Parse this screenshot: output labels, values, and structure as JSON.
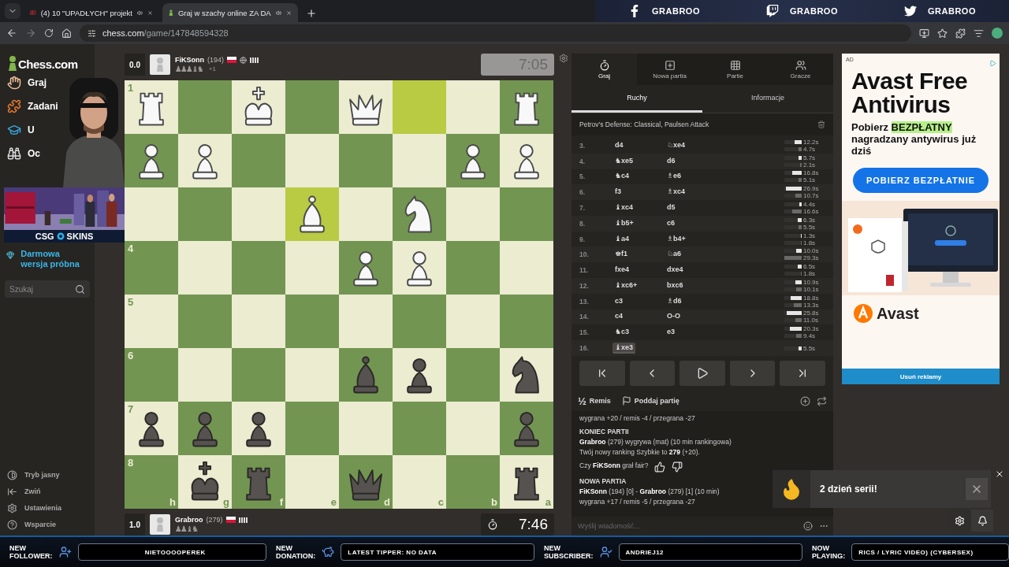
{
  "browser": {
    "tabs": [
      {
        "title": "(4) 10 \"UPADŁYCH\" projekt",
        "kind": "video",
        "selected": false,
        "audio": true
      },
      {
        "title": "Graj w szachy online ZA DA",
        "kind": "chess",
        "selected": true,
        "audio": true
      }
    ],
    "address": {
      "host": "chess.com",
      "path": "/game/147848594328"
    }
  },
  "socials": [
    {
      "kind": "facebook",
      "handle": "GRABROO"
    },
    {
      "kind": "twitch",
      "handle": "GRABROO"
    },
    {
      "kind": "twitter",
      "handle": "GRABROO"
    }
  ],
  "sidebar": {
    "logo": "Chess.com",
    "nav": [
      {
        "kind": "play",
        "label": "Graj"
      },
      {
        "kind": "puzzles",
        "label": "Zadani"
      },
      {
        "kind": "learn",
        "label": "U"
      },
      {
        "kind": "watch",
        "label": "Oc"
      }
    ],
    "trial": "Darmowa wersja próbna",
    "search": {
      "placeholder": "Szukaj"
    },
    "footer": [
      {
        "kind": "theme",
        "label": "Tryb jasny"
      },
      {
        "kind": "collapse",
        "label": "Zwiń"
      },
      {
        "kind": "settings",
        "label": "Ustawienia"
      },
      {
        "kind": "help",
        "label": "Wsparcie"
      }
    ]
  },
  "stream_banner": {
    "brand_left": "CSG",
    "brand_right": "SKINS"
  },
  "top_player": {
    "score": "0.0",
    "name": "FiKSonn",
    "rating": "(194)",
    "captured": "♟♟♟♝♞",
    "advantage": "+1",
    "clock": {
      "time": "7:05",
      "active": false
    }
  },
  "bottom_player": {
    "score": "1.0",
    "name": "Grabroo",
    "rating": "(279)",
    "captured": "♟♟♝♞",
    "clock": {
      "time": "7:46",
      "active": true
    }
  },
  "board": {
    "rows": [
      {
        "squares": [
          {
            "kind": "rook",
            "white": true,
            "highlighted": false,
            "rank_label": "1"
          },
          {
            "highlighted": false
          },
          {
            "kind": "king",
            "white": true,
            "highlighted": false
          },
          {
            "highlighted": false
          },
          {
            "kind": "queen",
            "white": true,
            "highlighted": false
          },
          {
            "highlighted": true
          },
          {
            "highlighted": false
          },
          {
            "kind": "rook",
            "white": true,
            "highlighted": false
          }
        ]
      },
      {
        "squares": [
          {
            "kind": "pawn",
            "white": true,
            "highlighted": false
          },
          {
            "kind": "pawn",
            "white": true,
            "highlighted": false
          },
          {
            "highlighted": false
          },
          {
            "highlighted": false
          },
          {
            "highlighted": false
          },
          {
            "highlighted": false
          },
          {
            "kind": "pawn",
            "white": true,
            "highlighted": false
          },
          {
            "kind": "pawn",
            "white": true,
            "highlighted": false
          }
        ]
      },
      {
        "squares": [
          {
            "highlighted": false
          },
          {
            "highlighted": false
          },
          {
            "highlighted": false
          },
          {
            "kind": "bishop",
            "white": true,
            "highlighted": true
          },
          {
            "highlighted": false
          },
          {
            "kind": "knight",
            "white": true,
            "highlighted": false
          },
          {
            "highlighted": false
          },
          {
            "highlighted": false
          }
        ]
      },
      {
        "squares": [
          {
            "highlighted": false,
            "rank_label": "4"
          },
          {
            "highlighted": false
          },
          {
            "highlighted": false
          },
          {
            "highlighted": false
          },
          {
            "kind": "pawn",
            "white": true,
            "highlighted": false
          },
          {
            "kind": "pawn",
            "white": true,
            "highlighted": false
          },
          {
            "highlighted": false
          },
          {
            "highlighted": false
          }
        ]
      },
      {
        "squares": [
          {
            "highlighted": false,
            "rank_label": "5"
          },
          {
            "highlighted": false
          },
          {
            "highlighted": false
          },
          {
            "highlighted": false
          },
          {
            "highlighted": false
          },
          {
            "highlighted": false
          },
          {
            "highlighted": false
          },
          {
            "highlighted": false
          }
        ]
      },
      {
        "squares": [
          {
            "highlighted": false,
            "rank_label": "6"
          },
          {
            "highlighted": false
          },
          {
            "highlighted": false
          },
          {
            "highlighted": false
          },
          {
            "kind": "bishop",
            "white": false,
            "highlighted": false
          },
          {
            "kind": "pawn",
            "white": false,
            "highlighted": false
          },
          {
            "highlighted": false
          },
          {
            "kind": "knight",
            "white": false,
            "highlighted": false
          }
        ]
      },
      {
        "squares": [
          {
            "kind": "pawn",
            "white": false,
            "highlighted": false,
            "rank_label": "7"
          },
          {
            "kind": "pawn",
            "white": false,
            "highlighted": false
          },
          {
            "kind": "pawn",
            "white": false,
            "highlighted": false
          },
          {
            "highlighted": false
          },
          {
            "highlighted": false
          },
          {
            "highlighted": false
          },
          {
            "highlighted": false
          },
          {
            "kind": "pawn",
            "white": false,
            "highlighted": false
          }
        ]
      },
      {
        "squares": [
          {
            "highlighted": false,
            "rank_label": "8",
            "file_label": "h"
          },
          {
            "kind": "king",
            "white": false,
            "highlighted": false,
            "file_label": "g"
          },
          {
            "kind": "rook",
            "white": false,
            "highlighted": false,
            "file_label": "f"
          },
          {
            "highlighted": false,
            "file_label": "e"
          },
          {
            "kind": "queen",
            "white": false,
            "highlighted": false,
            "file_label": "d"
          },
          {
            "highlighted": false,
            "file_label": "c"
          },
          {
            "highlighted": false,
            "file_label": "b"
          },
          {
            "kind": "rook",
            "white": false,
            "highlighted": false,
            "file_label": "a"
          }
        ]
      }
    ]
  },
  "panel": {
    "tabs": [
      {
        "kind": "play",
        "label": "Graj",
        "selected": true
      },
      {
        "kind": "new",
        "label": "Nowa partia",
        "selected": false
      },
      {
        "kind": "games",
        "label": "Partie",
        "selected": false
      },
      {
        "kind": "players",
        "label": "Gracze",
        "selected": false
      }
    ],
    "subtabs": [
      {
        "label": "Ruchy",
        "selected": true
      },
      {
        "label": "Informacje",
        "selected": false
      }
    ],
    "opening": "Petrov's Defense: Classical, Paulsen Attack",
    "moves": [
      {
        "number": "3.",
        "white": "d4",
        "black": "♘xe4",
        "white_time": "12.2s",
        "black_time": "4.7s",
        "white_bar": {
          "level": 0.41
        },
        "black_bar": {
          "level": 0.16
        },
        "white_selected": false,
        "black_selected": false
      },
      {
        "number": "4.",
        "white": "♞xe5",
        "black": "d6",
        "white_time": "5.7s",
        "black_time": "2.1s",
        "white_bar": {
          "level": 0.19
        },
        "black_bar": {
          "level": 0.07
        },
        "white_selected": false,
        "black_selected": false
      },
      {
        "number": "5.",
        "white": "♞c4",
        "black": "♗e6",
        "white_time": "16.8s",
        "black_time": "5.1s",
        "white_bar": {
          "level": 0.56
        },
        "black_bar": {
          "level": 0.17
        },
        "white_selected": false,
        "black_selected": false
      },
      {
        "number": "6.",
        "white": "f3",
        "black": "♗xc4",
        "white_time": "26.9s",
        "black_time": "10.7s",
        "white_bar": {
          "level": 0.9
        },
        "black_bar": {
          "level": 0.36
        },
        "white_selected": false,
        "black_selected": false
      },
      {
        "number": "7.",
        "white": "♝xc4",
        "black": "d5",
        "white_time": "4.4s",
        "black_time": "16.6s",
        "white_bar": {
          "level": 0.15
        },
        "black_bar": {
          "level": 0.55
        },
        "white_selected": false,
        "black_selected": false
      },
      {
        "number": "8.",
        "white": "♝b5+",
        "black": "c6",
        "white_time": "6.3s",
        "black_time": "5.5s",
        "white_bar": {
          "level": 0.21
        },
        "black_bar": {
          "level": 0.18
        },
        "white_selected": false,
        "black_selected": false
      },
      {
        "number": "9.",
        "white": "♝a4",
        "black": "♗b4+",
        "white_time": "1.3s",
        "black_time": "1.8s",
        "white_bar": {
          "level": 0.04
        },
        "black_bar": {
          "level": 0.06
        },
        "white_selected": false,
        "black_selected": false
      },
      {
        "number": "10.",
        "white": "♚f1",
        "black": "♘a6",
        "white_time": "10.0s",
        "black_time": "29.3s",
        "white_bar": {
          "level": 0.33
        },
        "black_bar": {
          "level": 0.98
        },
        "white_selected": false,
        "black_selected": false
      },
      {
        "number": "11.",
        "white": "fxe4",
        "black": "dxe4",
        "white_time": "6.5s",
        "black_time": "1.8s",
        "white_bar": {
          "level": 0.22
        },
        "black_bar": {
          "level": 0.06
        },
        "white_selected": false,
        "black_selected": false
      },
      {
        "number": "12.",
        "white": "♝xc6+",
        "black": "bxc6",
        "white_time": "10.9s",
        "black_time": "10.1s",
        "white_bar": {
          "level": 0.36
        },
        "black_bar": {
          "level": 0.34
        },
        "white_selected": false,
        "black_selected": false
      },
      {
        "number": "13.",
        "white": "c3",
        "black": "♗d6",
        "white_time": "18.8s",
        "black_time": "13.3s",
        "white_bar": {
          "level": 0.63
        },
        "black_bar": {
          "level": 0.44
        },
        "white_selected": false,
        "black_selected": false
      },
      {
        "number": "14.",
        "white": "c4",
        "black": "O-O",
        "white_time": "25.8s",
        "black_time": "11.0s",
        "white_bar": {
          "level": 0.86
        },
        "black_bar": {
          "level": 0.37
        },
        "white_selected": false,
        "black_selected": false
      },
      {
        "number": "15.",
        "white": "♞c3",
        "black": "e3",
        "white_time": "20.3s",
        "black_time": "9.4s",
        "white_bar": {
          "level": 0.68
        },
        "black_bar": {
          "level": 0.31
        },
        "white_selected": false,
        "black_selected": false
      },
      {
        "number": "16.",
        "white": "♝xe3",
        "white_time": "5.5s",
        "white_bar": {
          "level": 0.18
        },
        "white_selected": true
      }
    ],
    "nav": [
      {
        "kind": "first"
      },
      {
        "kind": "prev"
      },
      {
        "kind": "play"
      },
      {
        "kind": "next"
      },
      {
        "kind": "last"
      }
    ],
    "draw": {
      "symbol": "½",
      "label": "Remis"
    },
    "resign": {
      "label": "Poddaj partię"
    },
    "chat": [
      {
        "kind": "text",
        "text": "wygrana +20 / remis -4 / przegrana -27"
      },
      {
        "kind": "heading",
        "text": "KONIEC PARTII"
      },
      {
        "kind": "text",
        "text": "**Grabroo** (279) wygrywa (mat) (10 min rankingowa)"
      },
      {
        "kind": "text",
        "text": "Twój nowy ranking Szybkie to **279** (+20)."
      },
      {
        "kind": "fair_question",
        "text": "Czy **FiKSonn** grał fair?"
      },
      {
        "kind": "heading",
        "text": "NOWA PARTIA"
      },
      {
        "kind": "text",
        "text": "**FiKSonn** (194) [0] - **Grabroo** (279) [1] (10 min)"
      },
      {
        "kind": "text",
        "text": "wygrana +17 / remis -5 / przegrana -27"
      }
    ],
    "chat_input": {
      "placeholder": "Wyślij wiadomość..."
    }
  },
  "toast": {
    "text": "2 dzień serii!"
  },
  "ad": {
    "label": "AD",
    "headline": "Avast Free Antivirus",
    "body": "Pobierz **BEZPŁATNY** nagradzany antywirus już dziś",
    "cta": "POBIERZ BEZPŁATNIE",
    "brand": "Avast",
    "remove": "Usuń reklamy"
  },
  "alerts": [
    {
      "kind": "follower",
      "label": "NEW FOLLOWER:",
      "value": "NIETOOOOPEREK"
    },
    {
      "kind": "donation",
      "label": "NEW DONATION:",
      "value": "LATEST TIPPER: NO DATA"
    },
    {
      "kind": "subscriber",
      "label": "NEW SUBSCRIBER:",
      "value": "ANDRIEJ12"
    },
    {
      "kind": "now_playing",
      "label": "NOW PLAYING:",
      "value": "RICS / LYRIC VIDEO) (CYBERSEX)"
    }
  ]
}
